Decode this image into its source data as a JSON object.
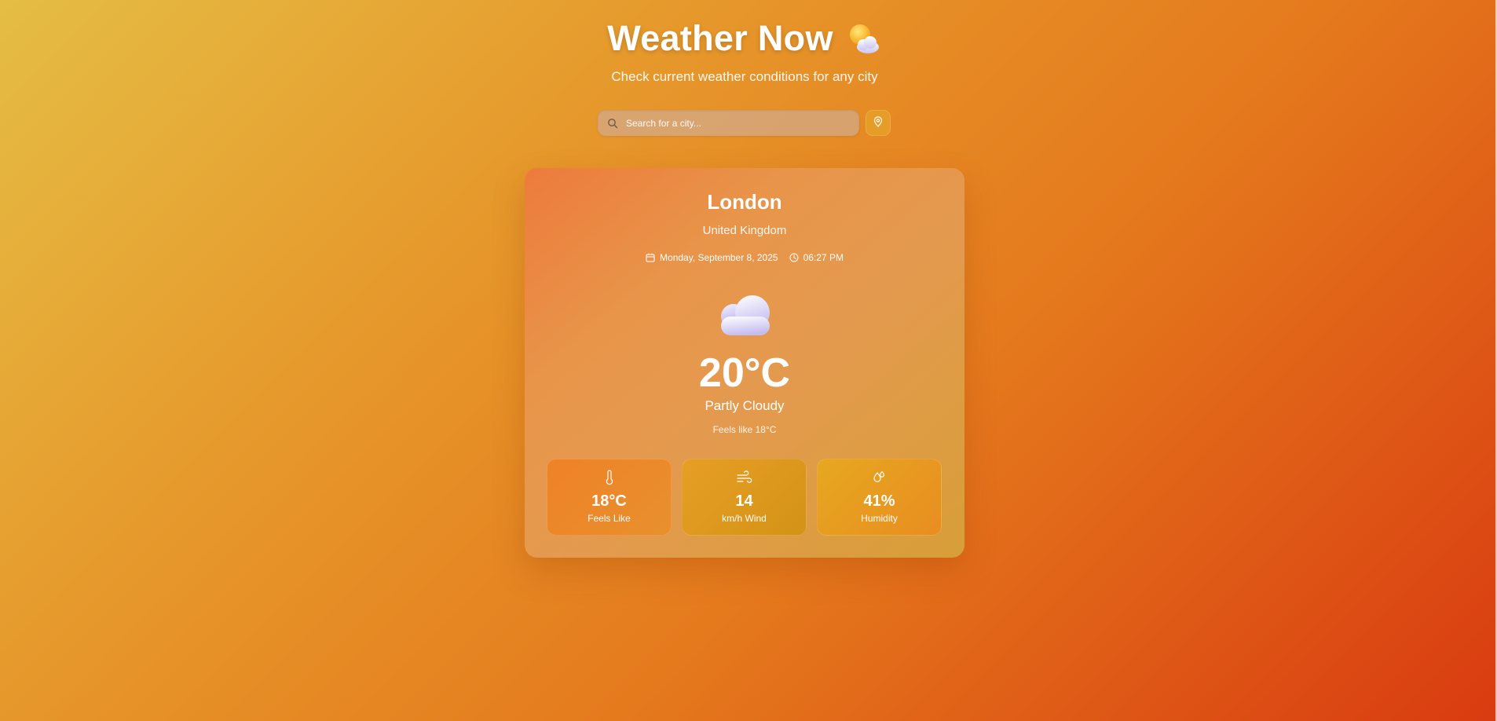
{
  "header": {
    "title": "Weather Now",
    "subtitle": "Check current weather conditions for any city",
    "title_icon": "sun-behind-cloud-icon"
  },
  "search": {
    "placeholder": "Search for a city...",
    "value": "",
    "search_icon": "search-icon",
    "location_icon": "map-pin-icon"
  },
  "weather": {
    "city": "London",
    "country": "United Kingdom",
    "date": "Monday, September 8, 2025",
    "time": "06:27 PM",
    "icon": "cloud-icon",
    "temperature": "20°C",
    "condition": "Partly Cloudy",
    "feels_like_text": "Feels like 18°C"
  },
  "stats": [
    {
      "icon": "thermometer-icon",
      "value": "18°C",
      "label": "Feels Like"
    },
    {
      "icon": "wind-icon",
      "value": "14",
      "label": "km/h Wind"
    },
    {
      "icon": "droplets-icon",
      "value": "41%",
      "label": "Humidity"
    }
  ],
  "colors": {
    "background_start": "#e5bd44",
    "background_end": "#d93b10",
    "text": "#ffffff"
  }
}
